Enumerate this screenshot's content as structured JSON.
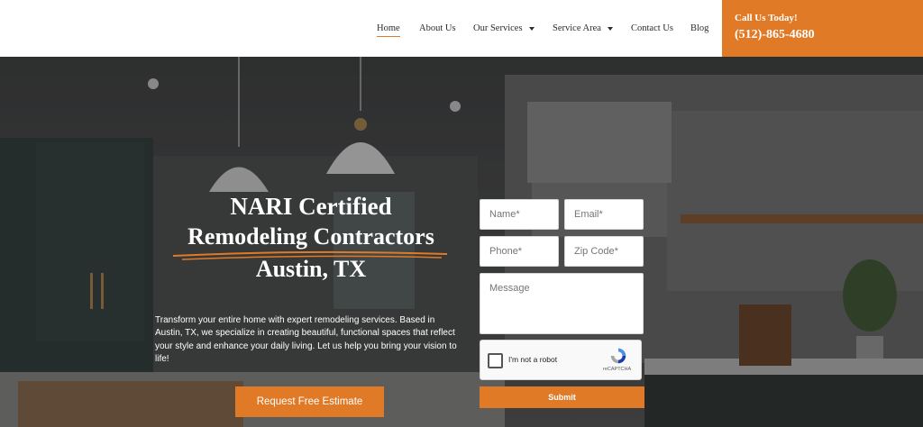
{
  "nav": {
    "items": [
      {
        "label": "Home",
        "active": true,
        "dropdown": false
      },
      {
        "label": "About Us",
        "active": false,
        "dropdown": false
      },
      {
        "label": "Our Services",
        "active": false,
        "dropdown": true
      },
      {
        "label": "Service Area",
        "active": false,
        "dropdown": true
      },
      {
        "label": "Contact Us",
        "active": false,
        "dropdown": false
      },
      {
        "label": "Blog",
        "active": false,
        "dropdown": false
      }
    ]
  },
  "call": {
    "label": "Call Us Today!",
    "number": "(512)-865-4680"
  },
  "hero": {
    "headline_1": "NARI Certified",
    "headline_2": "Remodeling Contractors",
    "headline_3": "Austin, TX",
    "intro": "Transform your entire home with expert remodeling services. Based in Austin, TX, we specialize in creating beautiful, functional spaces that reflect your style and enhance your daily living. Let us help you bring your vision to life!",
    "cta_label": "Request Free Estimate"
  },
  "form": {
    "name_placeholder": "Name*",
    "email_placeholder": "Email*",
    "phone_placeholder": "Phone*",
    "zip_placeholder": "Zip Code*",
    "message_placeholder": "Message",
    "captcha_label": "I'm not a robot",
    "captcha_brand": "reCAPTCHA",
    "submit_label": "Submit"
  },
  "colors": {
    "accent": "#e07a27",
    "header_bg": "#ffffff",
    "text_dark": "#2b2b2b"
  }
}
